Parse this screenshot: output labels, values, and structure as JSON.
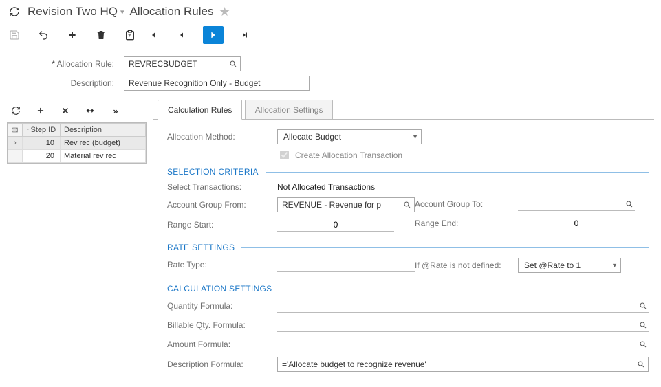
{
  "breadcrumb": {
    "org": "Revision Two HQ",
    "page": "Allocation Rules"
  },
  "header": {
    "allocation_rule_label": "Allocation Rule:",
    "allocation_rule_value": "REVRECBUDGET",
    "description_label": "Description:",
    "description_value": "Revenue Recognition Only - Budget"
  },
  "grid": {
    "columns": {
      "step_id": "Step ID",
      "description": "Description"
    },
    "rows": [
      {
        "step_id": "10",
        "description": "Rev rec (budget)",
        "selected": true
      },
      {
        "step_id": "20",
        "description": "Material rev rec",
        "selected": false
      }
    ]
  },
  "tabs": {
    "calc_rules": "Calculation Rules",
    "alloc_settings": "Allocation Settings"
  },
  "calc": {
    "alloc_method_label": "Allocation Method:",
    "alloc_method_value": "Allocate Budget",
    "create_tx_label": "Create Allocation Transaction",
    "sec_selection": "SELECTION CRITERIA",
    "select_tx_label": "Select Transactions:",
    "select_tx_value": "Not Allocated Transactions",
    "acct_from_label": "Account Group From:",
    "acct_from_value": "REVENUE - Revenue for p",
    "acct_to_label": "Account Group To:",
    "acct_to_value": "",
    "range_start_label": "Range Start:",
    "range_start_value": "0",
    "range_end_label": "Range End:",
    "range_end_value": "0",
    "sec_rate": "RATE SETTINGS",
    "rate_type_label": "Rate Type:",
    "rate_type_value": "",
    "rate_undef_label": "If @Rate is not defined:",
    "rate_undef_value": "Set @Rate to 1",
    "sec_calc": "CALCULATION SETTINGS",
    "qty_formula_label": "Quantity Formula:",
    "qty_formula_value": "",
    "bill_qty_label": "Billable Qty. Formula:",
    "bill_qty_value": "",
    "amount_formula_label": "Amount Formula:",
    "amount_formula_value": "",
    "desc_formula_label": "Description Formula:",
    "desc_formula_value": "='Allocate budget to recognize revenue'"
  }
}
